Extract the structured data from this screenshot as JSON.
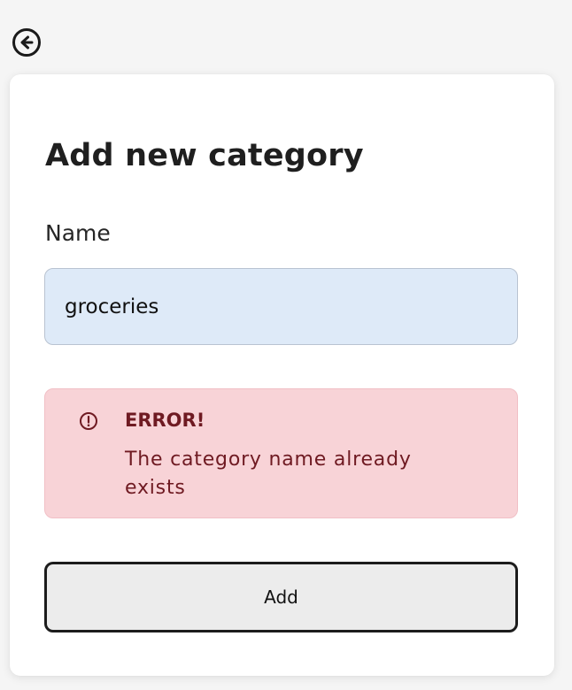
{
  "back": {
    "icon": "arrow-left-circle-icon"
  },
  "form": {
    "title": "Add new category",
    "name_label": "Name",
    "name_value": "groceries"
  },
  "alert": {
    "icon": "exclamation-circle-icon",
    "title": "ERROR!",
    "message": "The category name already exists",
    "colors": {
      "background": "#f8d3d7",
      "text": "#6f1a22"
    }
  },
  "actions": {
    "add_label": "Add"
  }
}
